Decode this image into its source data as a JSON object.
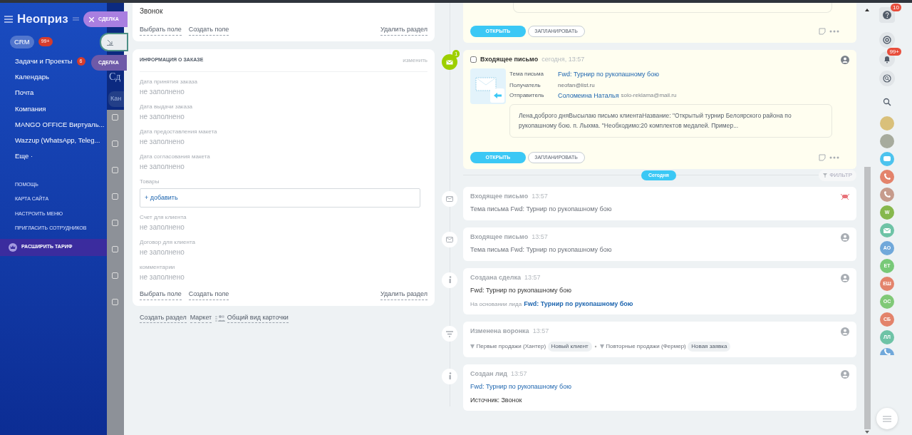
{
  "sidebar": {
    "logo": "Неоприз",
    "items": [
      {
        "label": "CRM",
        "badge": "99+",
        "selected": true
      },
      {
        "label": "Задачи и Проекты",
        "badge": "6",
        "selected": false
      },
      {
        "label": "Календарь",
        "selected": false
      },
      {
        "label": "Почта",
        "selected": false
      },
      {
        "label": "Компания",
        "selected": false
      },
      {
        "label": "MANGO OFFICE Виртуаль...",
        "selected": false
      },
      {
        "label": "Wazzup (WhatsApp, Teleg...",
        "selected": false
      },
      {
        "label": "Еще ·",
        "selected": false
      }
    ],
    "links": [
      "ПОМОЩЬ",
      "КАРТА САЙТА",
      "НАСТРОИТЬ МЕНЮ",
      "ПРИГЛАСИТЬ СОТРУДНИКОВ"
    ],
    "upgrade": "РАСШИРИТЬ ТАРИФ"
  },
  "background_page": {
    "title": "Сд",
    "filter": "Кан",
    "rows": [
      {
        "checked": false
      },
      {
        "checked": false
      },
      {
        "checked": false
      },
      {
        "checked": false
      },
      {
        "checked": false
      },
      {
        "checked": false
      },
      {
        "checked": false
      },
      {
        "checked": false
      }
    ]
  },
  "slider_tabs": [
    {
      "kind": "close",
      "label": "СДЕЛКА"
    },
    {
      "kind": "collapse"
    },
    {
      "kind": "plain",
      "label": "СДЕЛКА"
    }
  ],
  "source_card": {
    "value": "Звонок",
    "links": [
      "Выбрать поле",
      "Создать поле"
    ],
    "delete": "Удалить раздел"
  },
  "order_card": {
    "title": "ИНФОРМАЦИЯ О ЗАКАЗЕ",
    "edit": "изменить",
    "fields": [
      {
        "kind": "text",
        "label": "Дата принятия заказа",
        "value": "не заполнено"
      },
      {
        "kind": "text",
        "label": "Дата выдачи заказа",
        "value": "не заполнено"
      },
      {
        "kind": "text",
        "label": "Дата предоставления макета",
        "value": "не заполнено"
      },
      {
        "kind": "text",
        "label": "Дата согласования макета",
        "value": "не заполнено"
      },
      {
        "kind": "products",
        "label": "Товары",
        "value": "+ добавить"
      },
      {
        "kind": "text",
        "label": "Счет для клиента",
        "value": "не заполнено"
      },
      {
        "kind": "text",
        "label": "Договор для клиента",
        "value": "не заполнено"
      },
      {
        "kind": "text",
        "label": "комментарии",
        "value": "не заполнено"
      }
    ],
    "links": [
      "Выбрать поле",
      "Создать поле"
    ],
    "delete": "Удалить раздел"
  },
  "footer_links": [
    "Создать раздел",
    "Маркет"
  ],
  "card_view": "Общий вид карточки",
  "timeline": {
    "previous_buttons": [
      "ОТКРЫТЬ",
      "ЗАПЛАНИРОВАТЬ"
    ],
    "email": {
      "title": "Входящее письмо",
      "time": "сегодня, 13:57",
      "badge": "1",
      "checked": false,
      "fields": [
        {
          "label": "Тема письма",
          "value": "Fwd: Турнир по рукопашному бою",
          "link": true
        },
        {
          "label": "Получатель",
          "value": "neofan@list.ru",
          "link": false
        },
        {
          "label": "Отправитель",
          "value": "Соломеина Наталья",
          "extra": "solo-reklama@mail.ru",
          "link": true
        }
      ],
      "message": "Лена,доброго дняВысылаю письмо клиентаНазвание: \"Открытый турнир Белоярского района по рукопашному бою. п. Лыхма. \"Необходимо:20 комплектов медалей. Пример...",
      "buttons": [
        "ОТКРЫТЬ",
        "ЗАПЛАНИРОВАТЬ"
      ]
    },
    "divider": "Сегодня",
    "filter": "ФИЛЬТР",
    "events": [
      {
        "kind": "email",
        "robot": true,
        "title": "Входящее письмо",
        "time": "13:57",
        "lines": [
          {
            "text": "Тема письма Fwd: Турнир по рукопашному бою"
          }
        ]
      },
      {
        "kind": "email",
        "robot": false,
        "title": "Входящее письмо",
        "time": "13:57",
        "lines": [
          {
            "text": "Тема письма Fwd: Турнир по рукопашному бою"
          }
        ]
      },
      {
        "kind": "info",
        "robot": false,
        "title": "Создана сделка",
        "time": "13:57",
        "lines": [
          {
            "text": "Fwd: Турнир по рукопашному бою"
          },
          {
            "prefix": "На основании лида",
            "link": "Fwd: Турнир по рукопашному бою"
          }
        ]
      },
      {
        "kind": "funnel",
        "robot": false,
        "title": "Изменена воронка",
        "time": "13:57",
        "stages": [
          {
            "funnel": "Первые продажи (Хантер)",
            "stage": "Новый клиент"
          },
          {
            "funnel": "Повторные продажи (Фермер)",
            "stage": "Новая заявка"
          }
        ]
      },
      {
        "kind": "info",
        "robot": false,
        "title": "Создан лид",
        "time": "13:57",
        "lines": [
          {
            "link": "Fwd: Турнир по рукопашному бою"
          },
          {
            "text": "Источник: Звонок"
          }
        ]
      }
    ]
  },
  "right_bar": {
    "help_badge": "10",
    "bell_badge": "99+",
    "contacts": [
      {
        "kind": "group-photo"
      },
      {
        "kind": "person-photo"
      },
      {
        "kind": "chat",
        "color": "#4cc3ee"
      },
      {
        "kind": "phone",
        "color": "#e3836b"
      },
      {
        "kind": "phone",
        "color": "#c69b8c"
      },
      {
        "kind": "initials",
        "text": "W",
        "color": "#86b84d"
      },
      {
        "kind": "mail",
        "color": "#6ec3a6"
      },
      {
        "kind": "initials",
        "text": "АО",
        "color": "#70a8da"
      },
      {
        "kind": "initials",
        "text": "ЕТ",
        "color": "#78c978"
      },
      {
        "kind": "initials",
        "text": "ЕШ",
        "color": "#e3836b"
      },
      {
        "kind": "initials",
        "text": "ОС",
        "color": "#80c977"
      },
      {
        "kind": "initials",
        "text": "СБ",
        "color": "#e3836b"
      },
      {
        "kind": "initials",
        "text": "ЛЛ",
        "color": "#6ec3a6"
      },
      {
        "kind": "phone",
        "color": "#70a8da"
      }
    ]
  }
}
